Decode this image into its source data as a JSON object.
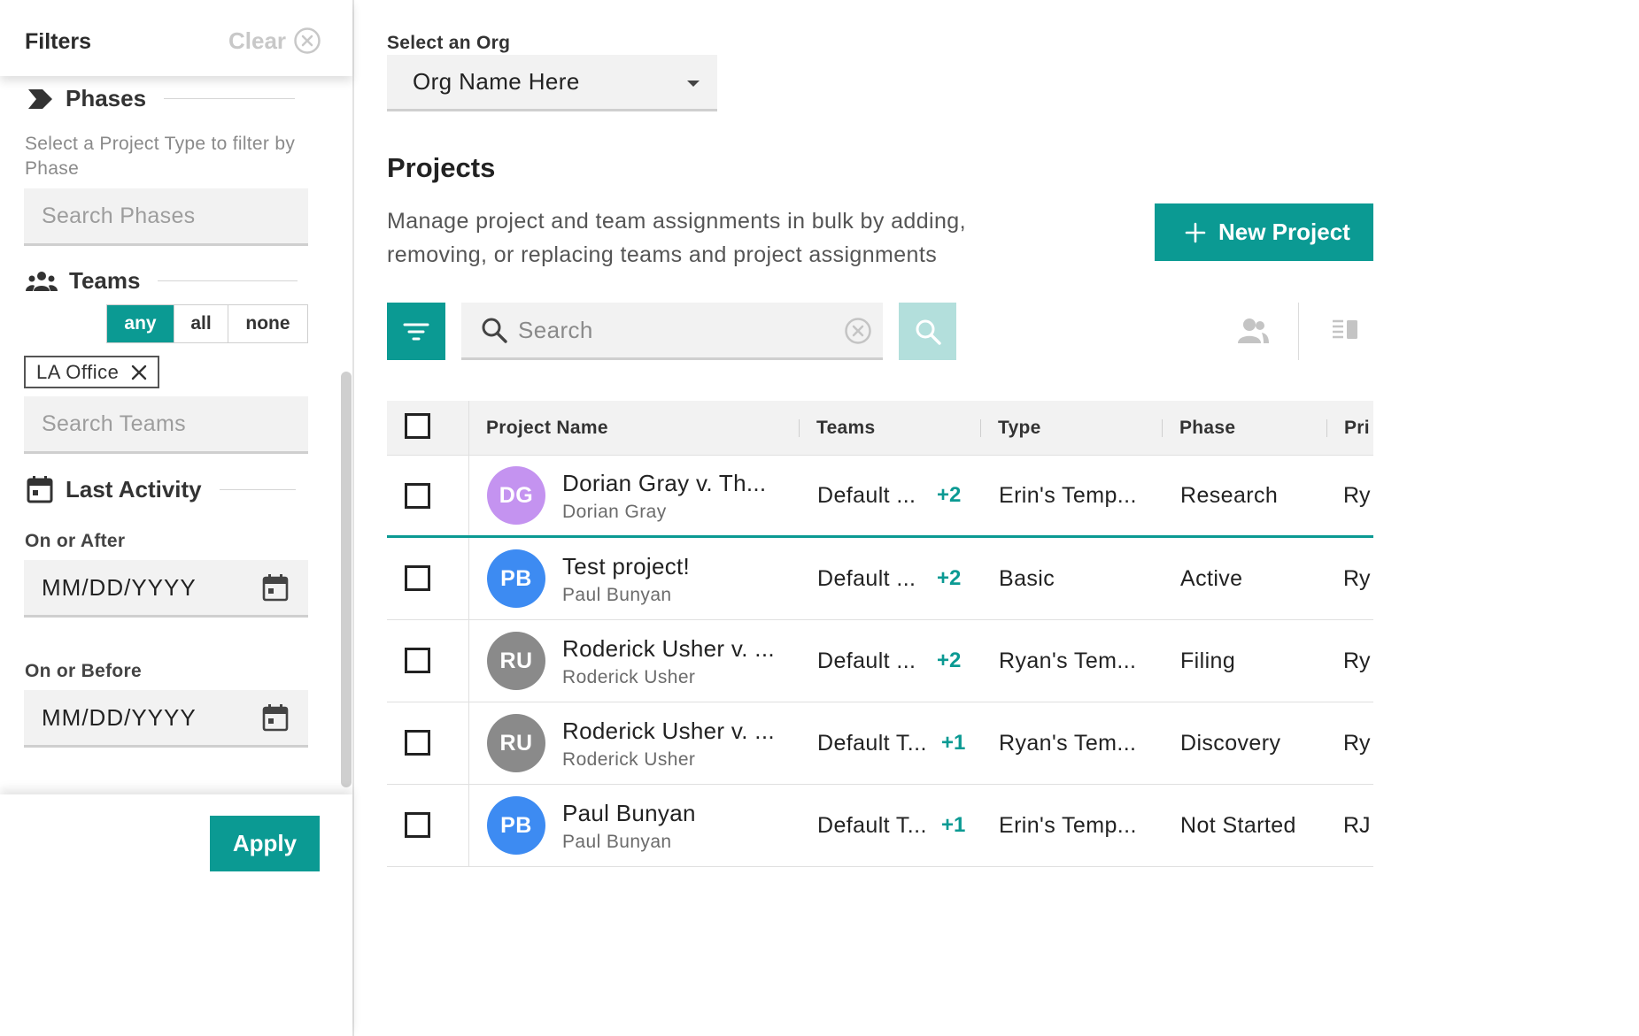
{
  "filters": {
    "title": "Filters",
    "clear_label": "Clear",
    "phases": {
      "label": "Phases",
      "hint": "Select a Project Type to filter by Phase",
      "search_placeholder": "Search Phases"
    },
    "teams": {
      "label": "Teams",
      "match_options": [
        "any",
        "all",
        "none"
      ],
      "selected_match": "any",
      "chips": [
        "LA Office"
      ],
      "search_placeholder": "Search Teams"
    },
    "last_activity": {
      "label": "Last Activity",
      "after_label": "On or After",
      "after_value": "MM/DD/YYYY",
      "before_label": "On or Before",
      "before_value": "MM/DD/YYYY"
    },
    "apply_label": "Apply"
  },
  "org": {
    "label": "Select an Org",
    "selected": "Org Name Here"
  },
  "page": {
    "title": "Projects",
    "description": "Manage project and team assignments in bulk by adding, removing, or replacing teams and project assignments",
    "new_button": "New Project"
  },
  "toolbar": {
    "search_placeholder": "Search"
  },
  "colors": {
    "accent": "#0b9a93",
    "accent_light": "#b3dfdc"
  },
  "table": {
    "columns": [
      "Project Name",
      "Teams",
      "Type",
      "Phase",
      "Pri"
    ],
    "rows": [
      {
        "initials": "DG",
        "avatar_color": "#c493f0",
        "name": "Dorian Gray v. Th...",
        "owner": "Dorian Gray",
        "teams": "Default ...",
        "extra": "+2",
        "type": "Erin's Temp...",
        "phase": "Research",
        "primary": "Ry"
      },
      {
        "initials": "PB",
        "avatar_color": "#3d8bf2",
        "name": "Test project!",
        "owner": "Paul Bunyan",
        "teams": "Default ...",
        "extra": "+2",
        "type": "Basic",
        "phase": "Active",
        "primary": "Ry"
      },
      {
        "initials": "RU",
        "avatar_color": "#8a8a8a",
        "name": "Roderick Usher v. ...",
        "owner": "Roderick Usher",
        "teams": "Default ...",
        "extra": "+2",
        "type": "Ryan's Tem...",
        "phase": "Filing",
        "primary": "Ry"
      },
      {
        "initials": "RU",
        "avatar_color": "#8a8a8a",
        "name": "Roderick Usher v. ...",
        "owner": "Roderick Usher",
        "teams": "Default T...",
        "extra": "+1",
        "type": "Ryan's Tem...",
        "phase": "Discovery",
        "primary": "Ry"
      },
      {
        "initials": "PB",
        "avatar_color": "#3d8bf2",
        "name": "Paul Bunyan",
        "owner": "Paul Bunyan",
        "teams": "Default T...",
        "extra": "+1",
        "type": "Erin's Temp...",
        "phase": "Not Started",
        "primary": "RJ"
      }
    ]
  }
}
